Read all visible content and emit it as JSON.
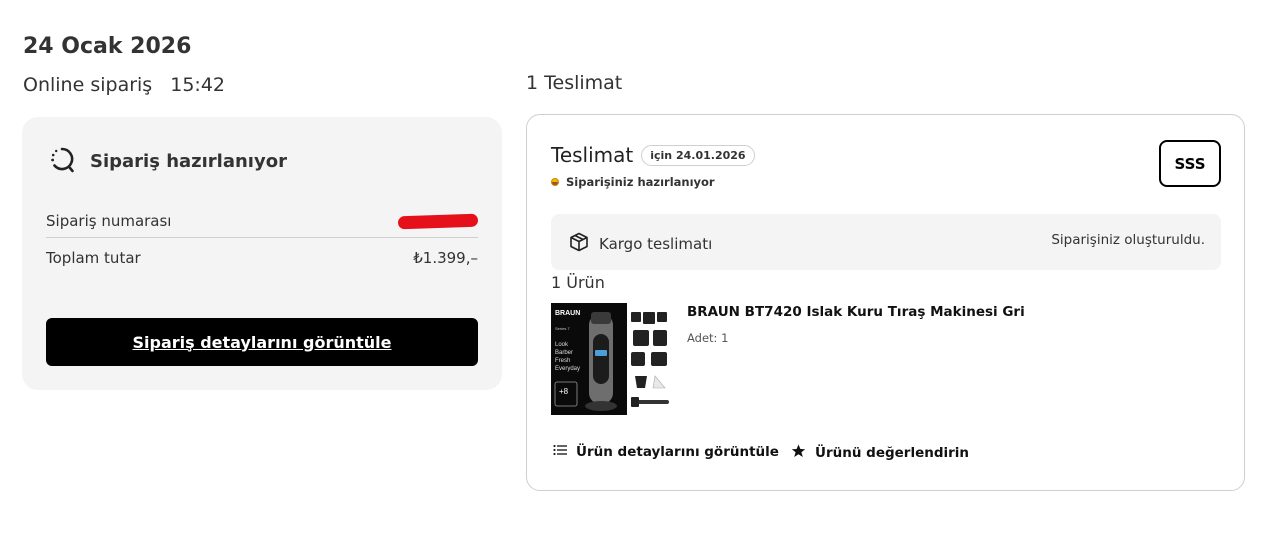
{
  "order": {
    "date": "24 Ocak 2026",
    "channel": "Online sipariş",
    "time": "15:42"
  },
  "summary": {
    "status_title": "Sipariş hazırlanıyor",
    "order_number_label": "Sipariş numarası",
    "total_label": "Toplam tutar",
    "total_value": "₺1.399,–",
    "details_button": "Sipariş detaylarını görüntüle"
  },
  "deliveries": {
    "count_label": "1 Teslimat",
    "title": "Teslimat",
    "date_pill": "için 24.01.2026",
    "status": "Siparişiniz hazırlanıyor",
    "faq_button": "SSS",
    "cargo_label": "Kargo teslimatı",
    "cargo_status": "Siparişiniz oluşturuldu.",
    "product_count": "1 Ürün",
    "product": {
      "name": "BRAUN BT7420 Islak Kuru Tıraş Makinesi Gri",
      "quantity": "Adet: 1",
      "image_text": {
        "brand": "BRAUN",
        "series": "Series 7",
        "line1": "Look",
        "line2": "Barber",
        "line3": "Fresh",
        "line4": "Everyday",
        "badge": "+8"
      }
    },
    "product_details_action": "Ürün detaylarını görüntüle",
    "review_action": "Ürünü değerlendirin"
  },
  "icons": {
    "status": "loading-circle-icon",
    "cargo": "package-box-icon",
    "list": "list-icon",
    "star": "star-icon"
  },
  "colors": {
    "redaction": "#e5101a",
    "primary_button": "#000000",
    "card_background": "#f4f4f4"
  }
}
